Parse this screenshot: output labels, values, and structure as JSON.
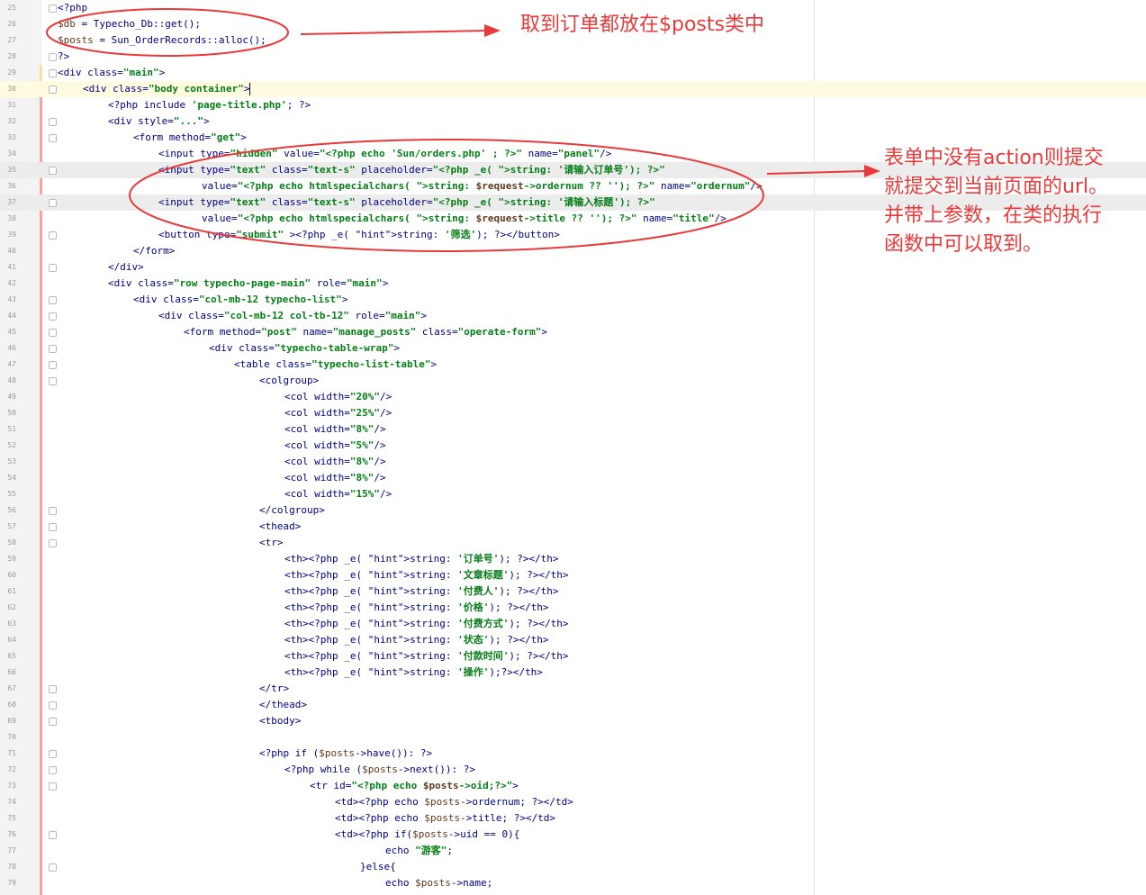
{
  "lines": [
    {
      "n": "25",
      "t": "<?php"
    },
    {
      "n": "26",
      "t": "$db = Typecho_Db::get();"
    },
    {
      "n": "27",
      "t": "$posts = Sun_OrderRecords::alloc();"
    },
    {
      "n": "28",
      "t": "?>"
    },
    {
      "n": "29",
      "t": "<div class=\"main\">"
    },
    {
      "n": "30",
      "t": "<div class=\"body container\">"
    },
    {
      "n": "31",
      "t": "<?php include 'page-title.php'; ?>"
    },
    {
      "n": "32",
      "t": "<div style=\"...\">"
    },
    {
      "n": "33",
      "t": "<form method=\"get\">"
    },
    {
      "n": "34",
      "t": "<input type=\"hidden\" value=\"<?php echo 'Sun/orders.php' ; ?>\" name=\"panel\"/>"
    },
    {
      "n": "35",
      "t": "<input type=\"text\" class=\"text-s\" placeholder=\"<?php _e( string: '请输入订单号'); ?>\""
    },
    {
      "n": "36",
      "t": "value=\"<?php echo htmlspecialchars( string: $request->ordernum ?? ''); ?>\" name=\"ordernum\"/>"
    },
    {
      "n": "37",
      "t": "<input type=\"text\" class=\"text-s\" placeholder=\"<?php _e( string: '请输入标题'); ?>\""
    },
    {
      "n": "38",
      "t": "value=\"<?php echo htmlspecialchars( string: $request->title ?? ''); ?>\" name=\"title\"/>"
    },
    {
      "n": "39",
      "t": "<button type=\"submit\" ><?php _e( string: '筛选'); ?></button>"
    },
    {
      "n": "40",
      "t": "</form>"
    },
    {
      "n": "41",
      "t": "</div>"
    },
    {
      "n": "42",
      "t": "<div class=\"row typecho-page-main\" role=\"main\">"
    },
    {
      "n": "43",
      "t": "<div class=\"col-mb-12 typecho-list\">"
    },
    {
      "n": "44",
      "t": "<div class=\"col-mb-12 col-tb-12\" role=\"main\">"
    },
    {
      "n": "45",
      "t": "<form method=\"post\" name=\"manage_posts\" class=\"operate-form\">"
    },
    {
      "n": "46",
      "t": "<div class=\"typecho-table-wrap\">"
    },
    {
      "n": "47",
      "t": "<table class=\"typecho-list-table\">"
    },
    {
      "n": "48",
      "t": "<colgroup>"
    },
    {
      "n": "49",
      "t": "<col width=\"20%\"/>"
    },
    {
      "n": "50",
      "t": "<col width=\"25%\"/>"
    },
    {
      "n": "51",
      "t": "<col width=\"8%\"/>"
    },
    {
      "n": "52",
      "t": "<col width=\"5%\"/>"
    },
    {
      "n": "53",
      "t": "<col width=\"8%\"/>"
    },
    {
      "n": "54",
      "t": "<col width=\"8%\"/>"
    },
    {
      "n": "55",
      "t": "<col width=\"15%\"/>"
    },
    {
      "n": "56",
      "t": "</colgroup>"
    },
    {
      "n": "57",
      "t": "<thead>"
    },
    {
      "n": "58",
      "t": "<tr>"
    },
    {
      "n": "59",
      "t": "<th><?php _e( string: '订单号'); ?></th>"
    },
    {
      "n": "60",
      "t": "<th><?php _e( string: '文章标题'); ?></th>"
    },
    {
      "n": "61",
      "t": "<th><?php _e( string: '付费人'); ?></th>"
    },
    {
      "n": "62",
      "t": "<th><?php _e( string: '价格'); ?></th>"
    },
    {
      "n": "63",
      "t": "<th><?php _e( string: '付费方式'); ?></th>"
    },
    {
      "n": "64",
      "t": "<th><?php _e( string: '状态'); ?></th>"
    },
    {
      "n": "65",
      "t": "<th><?php _e( string: '付款时间'); ?></th>"
    },
    {
      "n": "66",
      "t": "<th><?php _e( string: '操作');?></th>"
    },
    {
      "n": "67",
      "t": "</tr>"
    },
    {
      "n": "68",
      "t": "</thead>"
    },
    {
      "n": "69",
      "t": "<tbody>"
    },
    {
      "n": "70",
      "t": ""
    },
    {
      "n": "71",
      "t": "<?php if ($posts->have()): ?>"
    },
    {
      "n": "72",
      "t": "<?php while ($posts->next()): ?>"
    },
    {
      "n": "73",
      "t": "<tr id=\"<?php echo $posts->oid;?>\">"
    },
    {
      "n": "74",
      "t": "<td><?php echo $posts->ordernum; ?></td>"
    },
    {
      "n": "75",
      "t": "<td><?php echo $posts->title; ?></td>"
    },
    {
      "n": "76",
      "t": "<td><?php if($posts->uid == 0){"
    },
    {
      "n": "77",
      "t": "echo \"游客\";"
    },
    {
      "n": "78",
      "t": "}else{"
    },
    {
      "n": "79",
      "t": "echo $posts->name;"
    }
  ],
  "annotations": {
    "top_note": "取到订单都放在$posts类中",
    "side_note_lines": [
      "表单中没有action则提交",
      "就提交到当前页面的url。",
      "并带上参数，在类的执行",
      "函数中可以取到。"
    ]
  },
  "colors": {
    "annotation_red": "#e83a3a",
    "gutter_bg": "#f3f3f3",
    "current_line_bg": "#fffbe0"
  }
}
